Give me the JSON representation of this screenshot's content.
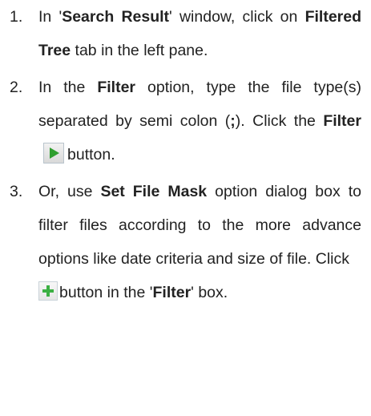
{
  "steps": [
    {
      "number": "1.",
      "t1": "In '",
      "b1": "Search Result",
      "t2": "' window, click on ",
      "b2": "Filtered Tree",
      "t3": " tab in the left pane."
    },
    {
      "number": "2.",
      "t1": "In the ",
      "b1": "Filter",
      "t2": " option, type the file type(s) separated by semi colon (",
      "b2": ";",
      "t3": "). Click the ",
      "b3": "Filter",
      "t4": "button."
    },
    {
      "number": "3.",
      "t1": "Or, use ",
      "b1": "Set File Mask",
      "t2": " option dialog box to filter files according to the more advance options like date criteria and size of file. Click ",
      "t3": "button in the '",
      "b2": "Filter",
      "t4": "' box."
    }
  ],
  "icons": {
    "filter_button": "play-icon",
    "add_mask_button": "plus-icon"
  },
  "colors": {
    "play_arrow": "#2e9e2e",
    "plus_sign": "#3cb043"
  }
}
